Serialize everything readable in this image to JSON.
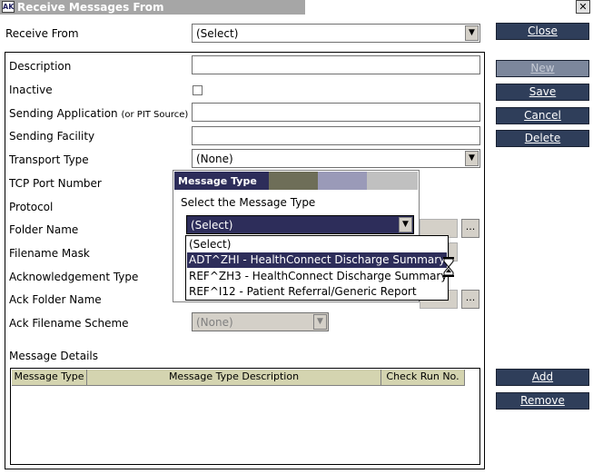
{
  "window": {
    "title": "Receive Messages From",
    "app_icon": "AK"
  },
  "receive_from": {
    "label": "Receive From",
    "value": "(Select)"
  },
  "form": {
    "description_label": "Description",
    "inactive_label": "Inactive",
    "sending_application_label": "Sending Application",
    "sending_application_hint": "(or PIT Source)",
    "sending_facility_label": "Sending Facility",
    "transport_type_label": "Transport Type",
    "transport_type_value": "(None)",
    "tcp_port_label": "TCP Port Number",
    "protocol_label": "Protocol",
    "folder_name_label": "Folder Name",
    "filename_mask_label": "Filename Mask",
    "ack_type_label": "Acknowledgement Type",
    "ack_folder_label": "Ack Folder Name",
    "ack_filename_label": "Ack Filename Scheme",
    "ack_filename_value": "(None)",
    "browse_label": "...",
    "message_details_label": "Message Details"
  },
  "buttons": {
    "close": "Close",
    "new": "New",
    "save": "Save",
    "cancel": "Cancel",
    "delete": "Delete",
    "add": "Add",
    "remove": "Remove"
  },
  "grid": {
    "columns": [
      "Message Type",
      "Message Type Description",
      "Check Run No."
    ]
  },
  "popup": {
    "title": "Message Type",
    "prompt": "Select the Message Type",
    "selected": "(Select)",
    "options": [
      "(Select)",
      "ADT^ZHI - HealthConnect Discharge Summary",
      "REF^ZH3 - HealthConnect Discharge Summary",
      "REF^I12 - Patient Referral/Generic Report"
    ],
    "highlighted_index": 1
  },
  "colors": {
    "button_bg": "#2f3e5a",
    "selection_bg": "#2d2d5a",
    "grid_header_bg": "#d4d4b0",
    "titlebar_bg": "#a6a6a6"
  },
  "icons": {
    "combo_arrow": "▼",
    "busy_cursor": "hourglass-icon",
    "close": "close-icon"
  }
}
